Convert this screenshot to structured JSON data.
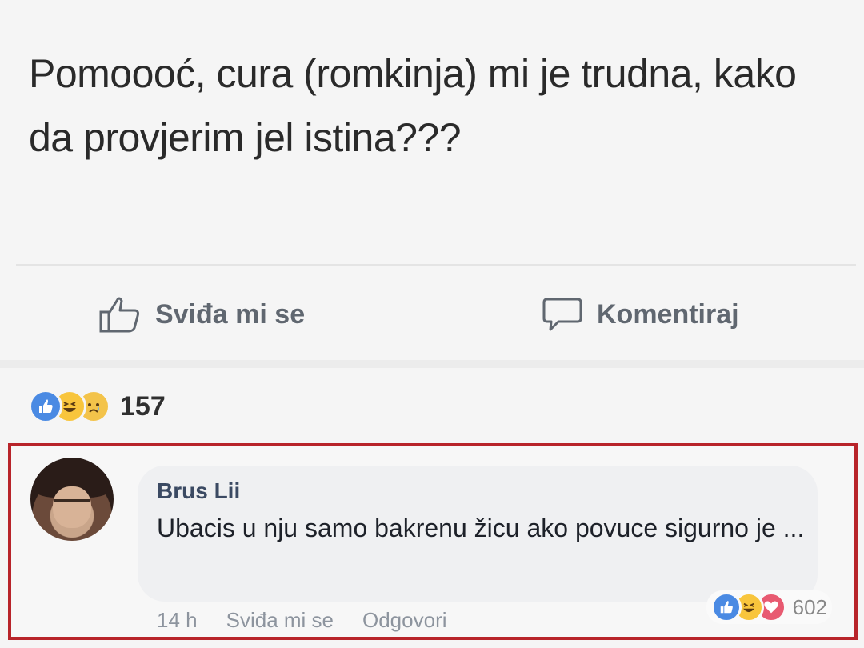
{
  "post": {
    "text": "Pomoooć, cura (romkinja) mi je trudna, kako da provjerim jel istina???"
  },
  "actions": {
    "like_label": "Sviđa mi se",
    "comment_label": "Komentiraj"
  },
  "reactions": {
    "icons": [
      "like-icon",
      "haha-icon",
      "sad-icon"
    ],
    "count": "157"
  },
  "comment": {
    "author": "Brus Lii",
    "text": "Ubacis u nju samo bakrenu žicu ako povuce sigurno je ...",
    "time": "14 h",
    "like_label": "Sviđa mi se",
    "reply_label": "Odgovori",
    "reactions_icons": [
      "like-icon",
      "haha-icon",
      "love-icon"
    ],
    "reactions_count": "602"
  },
  "colors": {
    "highlight_border": "#b8242a",
    "like_blue": "#4a8ae3",
    "haha_yellow": "#f8c53c",
    "love_red": "#e85a71"
  }
}
